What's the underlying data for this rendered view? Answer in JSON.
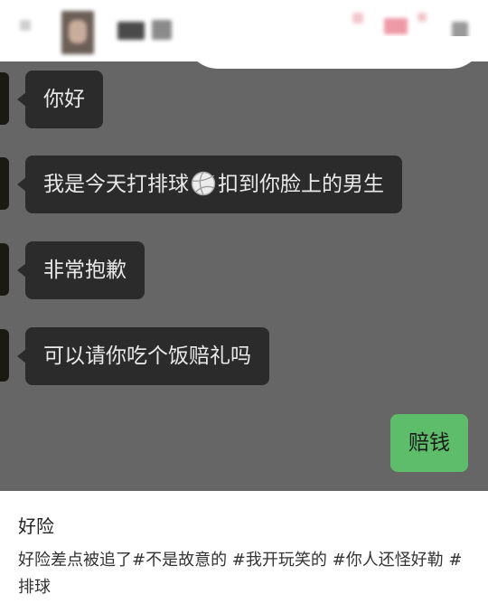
{
  "header": {
    "avatar_label": "avatar (blurred)",
    "name_label": "name (blurred)"
  },
  "chat": {
    "messages": [
      {
        "side": "left",
        "text": "你好"
      },
      {
        "side": "left",
        "text_before": "我是今天打排球",
        "emoji": "volleyball",
        "text_after": "扣到你脸上的男生"
      },
      {
        "side": "left",
        "text": "非常抱歉"
      },
      {
        "side": "left",
        "text": "可以请你吃个饭赔礼吗"
      },
      {
        "side": "right",
        "text": "赔钱"
      }
    ]
  },
  "caption": {
    "title": "好险",
    "body": "好险差点被追了#不是故意的 #我开玩笑的 #你人还怪好勒 #排球"
  },
  "colors": {
    "chat_background": "#666666",
    "incoming_bubble": "#2b2b2b",
    "outgoing_bubble": "#5ebd6a"
  }
}
